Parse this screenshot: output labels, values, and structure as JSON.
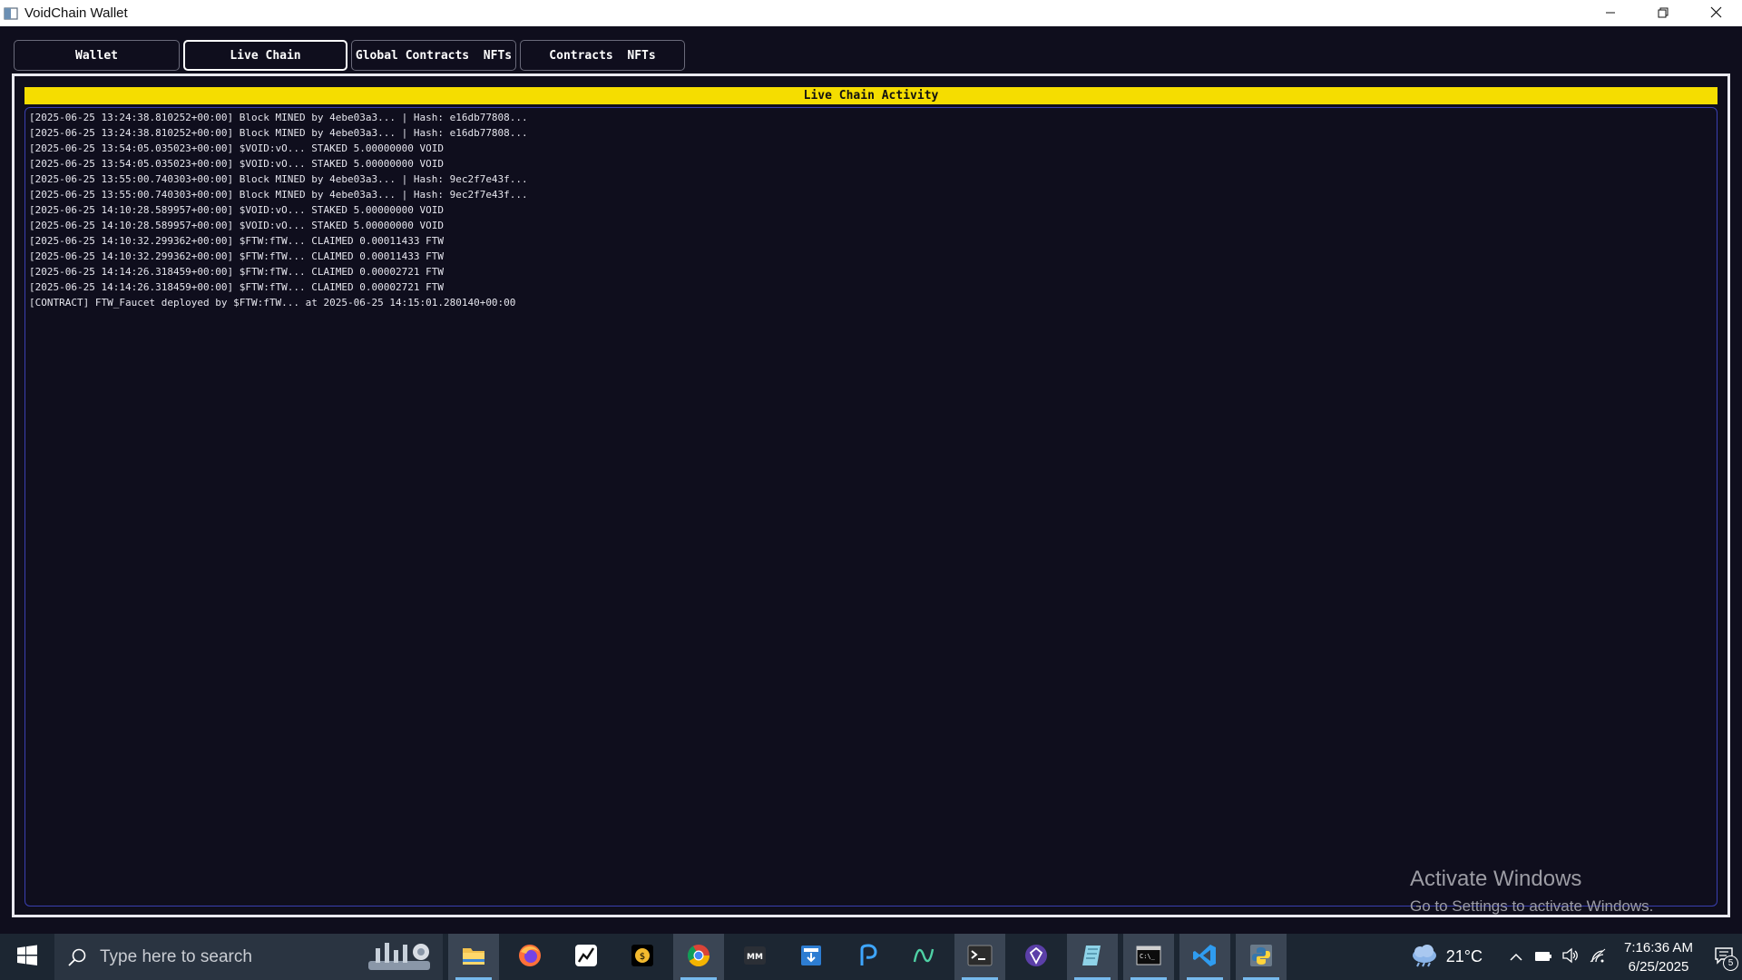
{
  "window": {
    "title": "VoidChain Wallet",
    "icon": "app-window-icon",
    "controls": [
      "minimize-icon",
      "restore-icon",
      "close-icon"
    ]
  },
  "tabs": [
    {
      "label": "Wallet",
      "active": false
    },
    {
      "label": "Live Chain",
      "active": true
    },
    {
      "label": "Global Contracts  NFTs",
      "active": false
    },
    {
      "label": "Contracts  NFTs",
      "active": false
    }
  ],
  "panel": {
    "header": "Live Chain Activity",
    "lines": [
      "[2025-06-25 13:24:38.810252+00:00] Block MINED by 4ebe03a3... | Hash: e16db77808...",
      "[2025-06-25 13:24:38.810252+00:00] Block MINED by 4ebe03a3... | Hash: e16db77808...",
      "[2025-06-25 13:54:05.035023+00:00] $VOID:vO... STAKED 5.00000000 VOID",
      "[2025-06-25 13:54:05.035023+00:00] $VOID:vO... STAKED 5.00000000 VOID",
      "[2025-06-25 13:55:00.740303+00:00] Block MINED by 4ebe03a3... | Hash: 9ec2f7e43f...",
      "[2025-06-25 13:55:00.740303+00:00] Block MINED by 4ebe03a3... | Hash: 9ec2f7e43f...",
      "[2025-06-25 14:10:28.589957+00:00] $VOID:vO... STAKED 5.00000000 VOID",
      "[2025-06-25 14:10:28.589957+00:00] $VOID:vO... STAKED 5.00000000 VOID",
      "[2025-06-25 14:10:32.299362+00:00] $FTW:fTW... CLAIMED 0.00011433 FTW",
      "[2025-06-25 14:10:32.299362+00:00] $FTW:fTW... CLAIMED 0.00011433 FTW",
      "[2025-06-25 14:14:26.318459+00:00] $FTW:fTW... CLAIMED 0.00002721 FTW",
      "[2025-06-25 14:14:26.318459+00:00] $FTW:fTW... CLAIMED 0.00002721 FTW",
      "[CONTRACT] FTW_Faucet deployed by $FTW:fTW... at 2025-06-25 14:15:01.280140+00:00"
    ]
  },
  "watermark": {
    "title": "Activate Windows",
    "subtitle": "Go to Settings to activate Windows."
  },
  "taskbar": {
    "search_placeholder": "Type here to search",
    "apps": [
      {
        "icon": "file-explorer-icon",
        "running": true,
        "highlight": true
      },
      {
        "icon": "firefox-icon",
        "running": false
      },
      {
        "icon": "stocks-app-icon",
        "running": false
      },
      {
        "icon": "coin-app-icon",
        "running": false
      },
      {
        "icon": "chrome-icon",
        "running": true,
        "highlight": true
      },
      {
        "icon": "mm-app-icon",
        "running": false
      },
      {
        "icon": "installer-icon",
        "running": false
      },
      {
        "icon": "p-app-icon",
        "running": false
      },
      {
        "icon": "wave-app-icon",
        "running": false
      },
      {
        "icon": "terminal-icon",
        "running": true,
        "highlight": true
      },
      {
        "icon": "gem-app-icon",
        "running": false
      },
      {
        "icon": "notes-app-icon",
        "running": true,
        "highlight": true
      },
      {
        "icon": "command-prompt-icon",
        "running": true,
        "highlight": true
      },
      {
        "icon": "vscode-icon",
        "running": true,
        "highlight": true
      },
      {
        "icon": "python-icon",
        "running": true,
        "highlight": true
      }
    ],
    "weather": {
      "icon": "weather-cloud-icon",
      "temperature": "21°C"
    },
    "time": "7:16:36 AM",
    "date": "6/25/2025",
    "notification_count": "5"
  },
  "colors": {
    "background": "#0f0e1d",
    "header_bar": "#f5dd00",
    "log_border": "#3a3fb0",
    "taskbar": "#1c2632"
  }
}
